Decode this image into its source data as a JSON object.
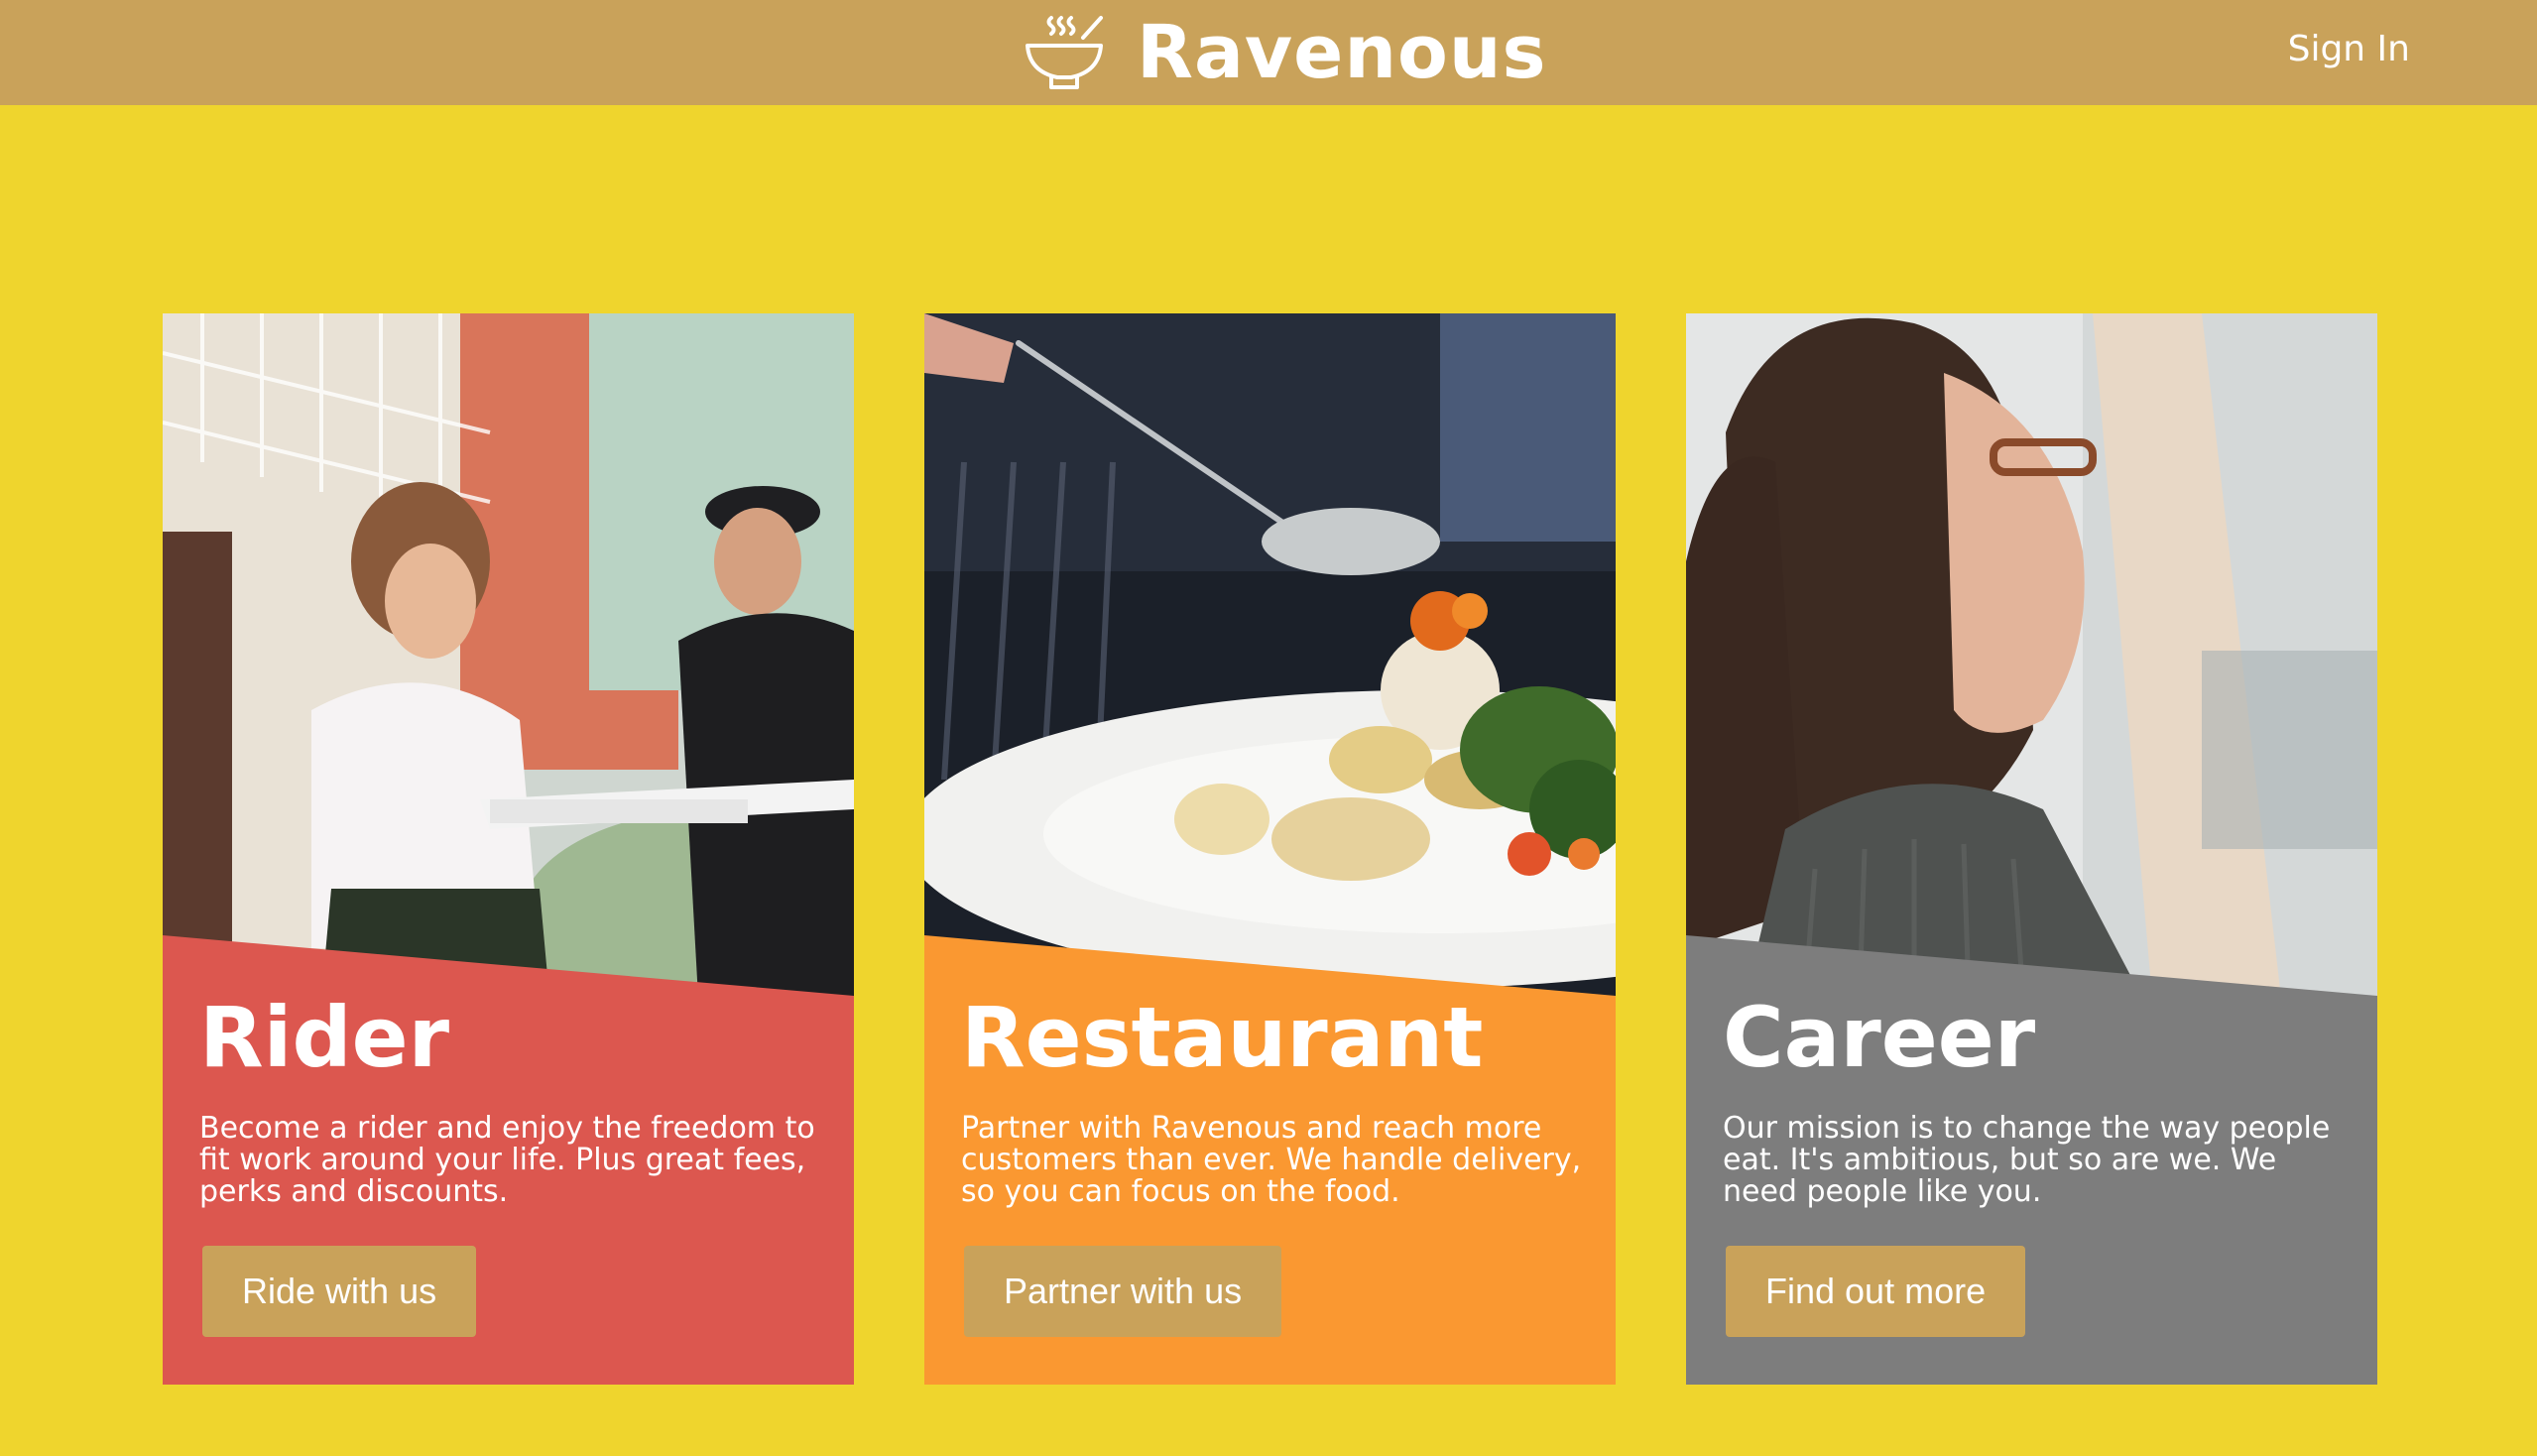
{
  "header": {
    "brand_name": "Ravenous",
    "logo_icon": "steaming-bowl-icon",
    "sign_in_label": "Sign In"
  },
  "colors": {
    "background": "#efd52d",
    "header": "#c9a25a",
    "button": "#c9a25a",
    "rider_panel": "#dc574f",
    "restaurant_panel": "#fa9831",
    "career_panel": "#7d7d7d",
    "text": "#ffffff"
  },
  "cards": [
    {
      "title": "Rider",
      "text": "Become a rider and enjoy the freedom to fit work around your life. Plus great fees, perks and discounts.",
      "button_label": "Ride with us",
      "image": "pizza-delivery-photo"
    },
    {
      "title": "Restaurant",
      "text": "Partner with Ravenous and reach more customers than ever. We handle delivery, so you can focus on the food.",
      "button_label": "Partner with us",
      "image": "plated-dish-photo"
    },
    {
      "title": "Career",
      "text": "Our mission is to change the way people eat. It's ambitious, but so are we. We need people like you.",
      "button_label": "Find out more",
      "image": "woman-portrait-photo"
    }
  ]
}
